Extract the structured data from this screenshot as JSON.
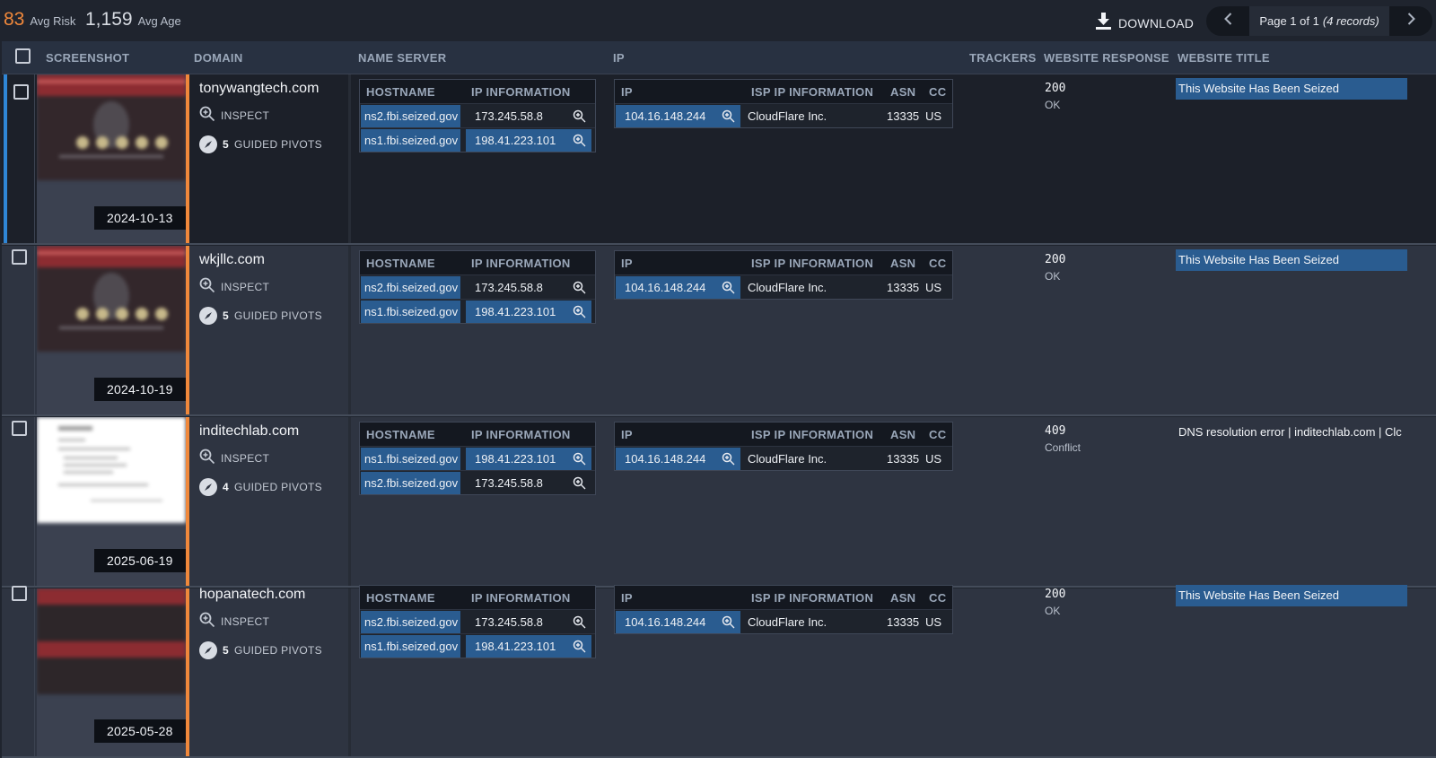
{
  "stats": {
    "risk_value": "83",
    "risk_label": "Avg Risk",
    "age_value": "1,159",
    "age_label": "Avg Age"
  },
  "toolbar": {
    "download_label": "DOWNLOAD",
    "page_text": "Page 1 of 1",
    "records_text": "(4 records)"
  },
  "columns": {
    "screenshot": "SCREENSHOT",
    "domain": "DOMAIN",
    "name_server": "NAME SERVER",
    "ip": "IP",
    "trackers": "TRACKERS",
    "website_response": "WEBSITE RESPONSE",
    "website_title": "WEBSITE TITLE"
  },
  "subcolumns": {
    "hostname": "HOSTNAME",
    "ip_information": "IP INFORMATION",
    "ip": "IP",
    "isp_ip_information": "ISP IP INFORMATION",
    "asn": "ASN",
    "cc": "CC"
  },
  "actions": {
    "inspect": "INSPECT",
    "guided_pivots": "GUIDED PIVOTS"
  },
  "rows": [
    {
      "date": "2024-10-13",
      "domain": "tonywangtech.com",
      "pivots": "5",
      "ns": [
        {
          "host": "ns2.fbi.seized.gov",
          "ip": "173.245.58.8"
        },
        {
          "host": "ns1.fbi.seized.gov",
          "ip": "198.41.223.101"
        }
      ],
      "ip": {
        "address": "104.16.148.244",
        "isp": "CloudFlare Inc.",
        "asn": "13335",
        "cc": "US"
      },
      "response_code": "200",
      "response_status": "OK",
      "title": "This Website Has Been Seized"
    },
    {
      "date": "2024-10-19",
      "domain": "wkjllc.com",
      "pivots": "5",
      "ns": [
        {
          "host": "ns2.fbi.seized.gov",
          "ip": "173.245.58.8"
        },
        {
          "host": "ns1.fbi.seized.gov",
          "ip": "198.41.223.101"
        }
      ],
      "ip": {
        "address": "104.16.148.244",
        "isp": "CloudFlare Inc.",
        "asn": "13335",
        "cc": "US"
      },
      "response_code": "200",
      "response_status": "OK",
      "title": "This Website Has Been Seized"
    },
    {
      "date": "2025-06-19",
      "domain": "inditechlab.com",
      "pivots": "4",
      "ns": [
        {
          "host": "ns1.fbi.seized.gov",
          "ip": "198.41.223.101"
        },
        {
          "host": "ns2.fbi.seized.gov",
          "ip": "173.245.58.8"
        }
      ],
      "ip": {
        "address": "104.16.148.244",
        "isp": "CloudFlare Inc.",
        "asn": "13335",
        "cc": "US"
      },
      "response_code": "409",
      "response_status": "Conflict",
      "title": "DNS resolution error | inditechlab.com | Clc"
    },
    {
      "date": "2025-05-28",
      "domain": "hopanatech.com",
      "pivots": "5",
      "ns": [
        {
          "host": "ns2.fbi.seized.gov",
          "ip": "173.245.58.8"
        },
        {
          "host": "ns1.fbi.seized.gov",
          "ip": "198.41.223.101"
        }
      ],
      "ip": {
        "address": "104.16.148.244",
        "isp": "CloudFlare Inc.",
        "asn": "13335",
        "cc": "US"
      },
      "response_code": "200",
      "response_status": "OK",
      "title": "This Website Has Been Seized"
    }
  ],
  "colors": {
    "accent_orange": "#f0883b",
    "highlight_blue": "#2a5c90",
    "selected_bar": "#2f86d6"
  },
  "icons": [
    "download-icon",
    "chevron-left-icon",
    "chevron-right-icon",
    "magnifier-icon",
    "compass-icon"
  ]
}
